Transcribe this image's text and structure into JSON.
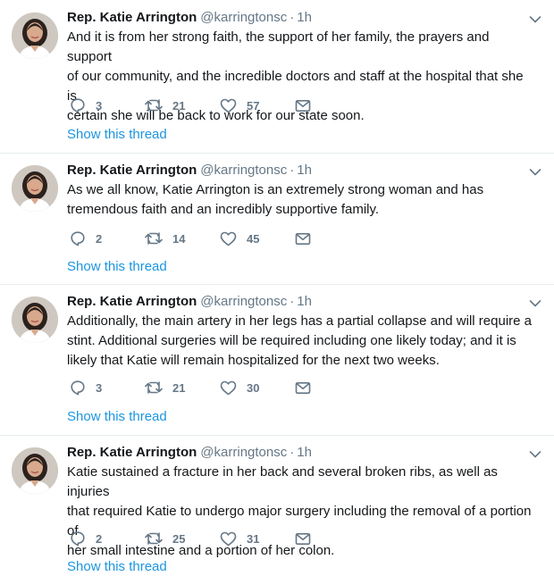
{
  "tweets": [
    {
      "name": "Rep. Katie Arrington",
      "handle": "@karringtonsc",
      "separator": "·",
      "time": "1h",
      "text": "And it is from her strong faith, the support of her family, the prayers and support\nof our community, and the incredible doctors and staff at the hospital that she is\ncertain she will be back to work for our state soon.",
      "replies": "3",
      "retweets": "21",
      "likes": "57",
      "thread_link": "Show this thread"
    },
    {
      "name": "Rep. Katie Arrington",
      "handle": "@karringtonsc",
      "separator": "·",
      "time": "1h",
      "text": "As we all know, Katie Arrington is an extremely strong woman and has\ntremendous faith and an incredibly supportive family.",
      "replies": "2",
      "retweets": "14",
      "likes": "45",
      "thread_link": "Show this thread"
    },
    {
      "name": "Rep. Katie Arrington",
      "handle": "@karringtonsc",
      "separator": "·",
      "time": "1h",
      "text": "Additionally, the main artery in her legs has a partial collapse and will require a\nstint. Additional surgeries will be required including one likely today; and it is\nlikely that Katie will remain hospitalized for the next two weeks.",
      "replies": "3",
      "retweets": "21",
      "likes": "30",
      "thread_link": "Show this thread"
    },
    {
      "name": "Rep. Katie Arrington",
      "handle": "@karringtonsc",
      "separator": "·",
      "time": "1h",
      "text": "Katie sustained a fracture in her back and several broken ribs, as well as injuries\nthat required Katie to undergo major surgery including the removal of a portion of\nher small intestine and a portion of her colon.",
      "replies": "2",
      "retweets": "25",
      "likes": "31",
      "thread_link": "Show this thread"
    }
  ],
  "colors": {
    "link": "#1b95e0",
    "muted": "#657786",
    "text": "#14171a",
    "divider": "#e6ecf0"
  },
  "icons": [
    "reply-icon",
    "retweet-icon",
    "like-icon",
    "direct-message-icon",
    "chevron-down-icon"
  ]
}
